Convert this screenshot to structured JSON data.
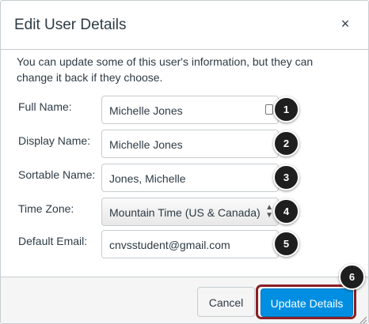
{
  "dialog": {
    "title": "Edit User Details",
    "close_symbol": "×",
    "intro": "You can update some of this user's information, but they can change it back if they choose."
  },
  "fields": [
    {
      "label": "Full Name:",
      "value": "Michelle Jones",
      "type": "text",
      "icon": "contact-card-icon",
      "badge": "1"
    },
    {
      "label": "Display Name:",
      "value": "Michelle Jones",
      "type": "text",
      "badge": "2"
    },
    {
      "label": "Sortable Name:",
      "value": "Jones, Michelle",
      "type": "text",
      "badge": "3"
    },
    {
      "label": "Time Zone:",
      "value": "Mountain Time (US & Canada)",
      "type": "select",
      "badge": "4"
    },
    {
      "label": "Default Email:",
      "value": "cnvsstudent@gmail.com",
      "type": "text",
      "badge": "5"
    }
  ],
  "footer": {
    "cancel_label": "Cancel",
    "update_label": "Update Details",
    "update_badge": "6"
  },
  "colors": {
    "primary": "#008ee2",
    "highlight": "#8b1f24",
    "badge": "#1e1e1e"
  }
}
